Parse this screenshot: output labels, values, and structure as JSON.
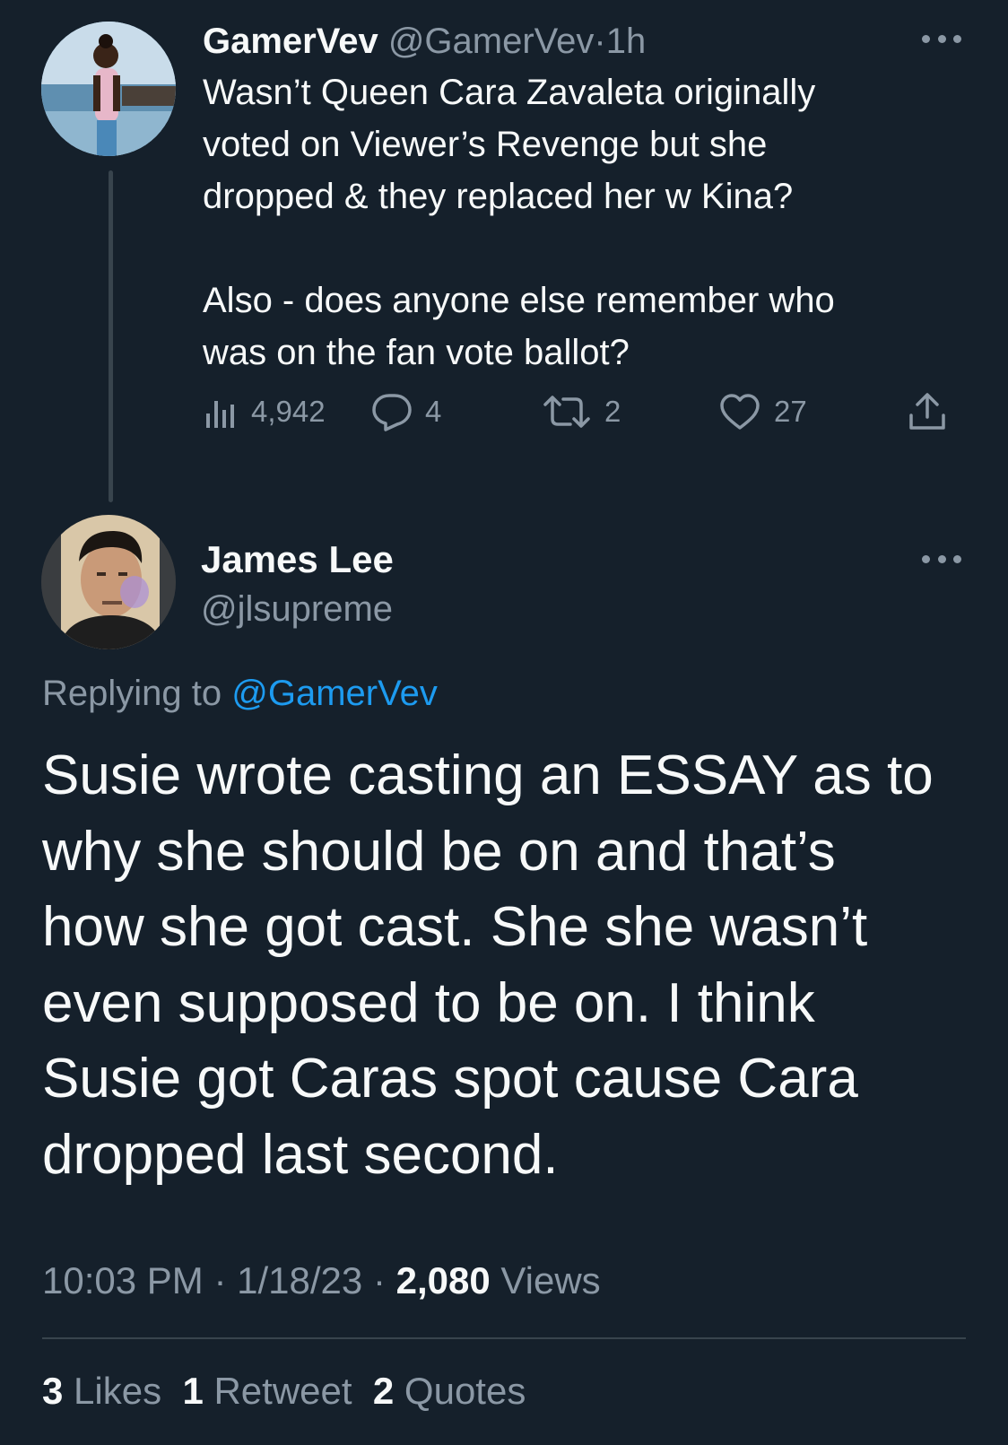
{
  "parent_tweet": {
    "display_name": "GamerVev",
    "handle": "@GamerVev",
    "separator": "·",
    "time": "1h",
    "text": "Wasn’t Queen Cara Zavaleta originally\nvoted on Viewer’s Revenge but she\ndropped & they replaced her w Kina?\n\nAlso - does anyone else remember who\nwas on the fan vote ballot?",
    "actions": {
      "views": "4,942",
      "replies": "4",
      "retweets": "2",
      "likes": "27"
    },
    "icons": [
      "views-icon",
      "reply-icon",
      "retweet-icon",
      "like-icon",
      "share-icon",
      "more-icon"
    ]
  },
  "reply_tweet": {
    "display_name": "James Lee",
    "handle": "@jlsupreme",
    "replying_prefix": "Replying to",
    "replying_to": "@GamerVev",
    "text": "Susie wrote casting an ESSAY as to\nwhy she should be on and that’s\nhow she got cast. She she wasn’t\neven supposed to be on. I think\nSusie got Caras spot cause Cara\ndropped last second.",
    "time": "10:03 PM",
    "date": "1/18/23",
    "separator": "·",
    "views_count": "2,080",
    "views_label": "Views",
    "stats": {
      "likes_count": "3",
      "likes_label": "Likes",
      "retweets_count": "1",
      "retweets_label": "Retweet",
      "quotes_count": "2",
      "quotes_label": "Quotes"
    }
  },
  "colors": {
    "background": "#15202b",
    "text": "#f7f9f9",
    "muted": "#8b98a5",
    "link": "#1d9bf0",
    "divider": "#38444d"
  }
}
